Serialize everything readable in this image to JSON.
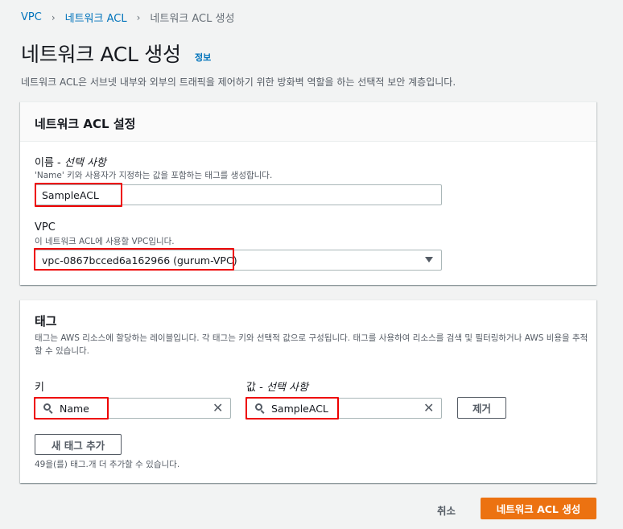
{
  "breadcrumb": {
    "items": [
      "VPC",
      "네트워크 ACL",
      "네트워크 ACL 생성"
    ],
    "sep": "›"
  },
  "page": {
    "title": "네트워크 ACL 생성",
    "info": "정보",
    "description": "네트워크 ACL은 서브넷 내부와 외부의 트래픽을 제어하기 위한 방화벽 역할을 하는 선택적 보안 계층입니다."
  },
  "settings": {
    "header": "네트워크 ACL 설정",
    "name_label": "이름 -",
    "name_optional": "선택 사항",
    "name_desc": "'Name' 키와 사용자가 지정하는 값을 포함하는 태그를 생성합니다.",
    "name_value": "SampleACL",
    "vpc_label": "VPC",
    "vpc_desc": "이 네트워크 ACL에 사용할 VPC입니다.",
    "vpc_value": "vpc-0867bcced6a162966 (gurum-VPC)"
  },
  "tags": {
    "header": "태그",
    "description": "태그는 AWS 리소스에 할당하는 레이블입니다. 각 태그는 키와 선택적 값으로 구성됩니다. 태그를 사용하여 리소스를 검색 및 필터링하거나 AWS 비용을 추적할 수 있습니다.",
    "key_label": "키",
    "value_label": "값 -",
    "value_optional": "선택 사항",
    "key_value": "Name",
    "value_value": "SampleACL",
    "remove_label": "제거",
    "add_label": "새 태그 추가",
    "limit_text": "49을(를) 태그.개 더 추가할 수 있습니다."
  },
  "footer": {
    "cancel_label": "취소",
    "create_label": "네트워크 ACL 생성"
  },
  "colors": {
    "accent": "#ec7211",
    "link": "#0073bb",
    "highlight": "#e00000"
  },
  "icons": {
    "search": "search-icon",
    "clear": "close-icon",
    "dropdown": "caret-down-icon"
  }
}
